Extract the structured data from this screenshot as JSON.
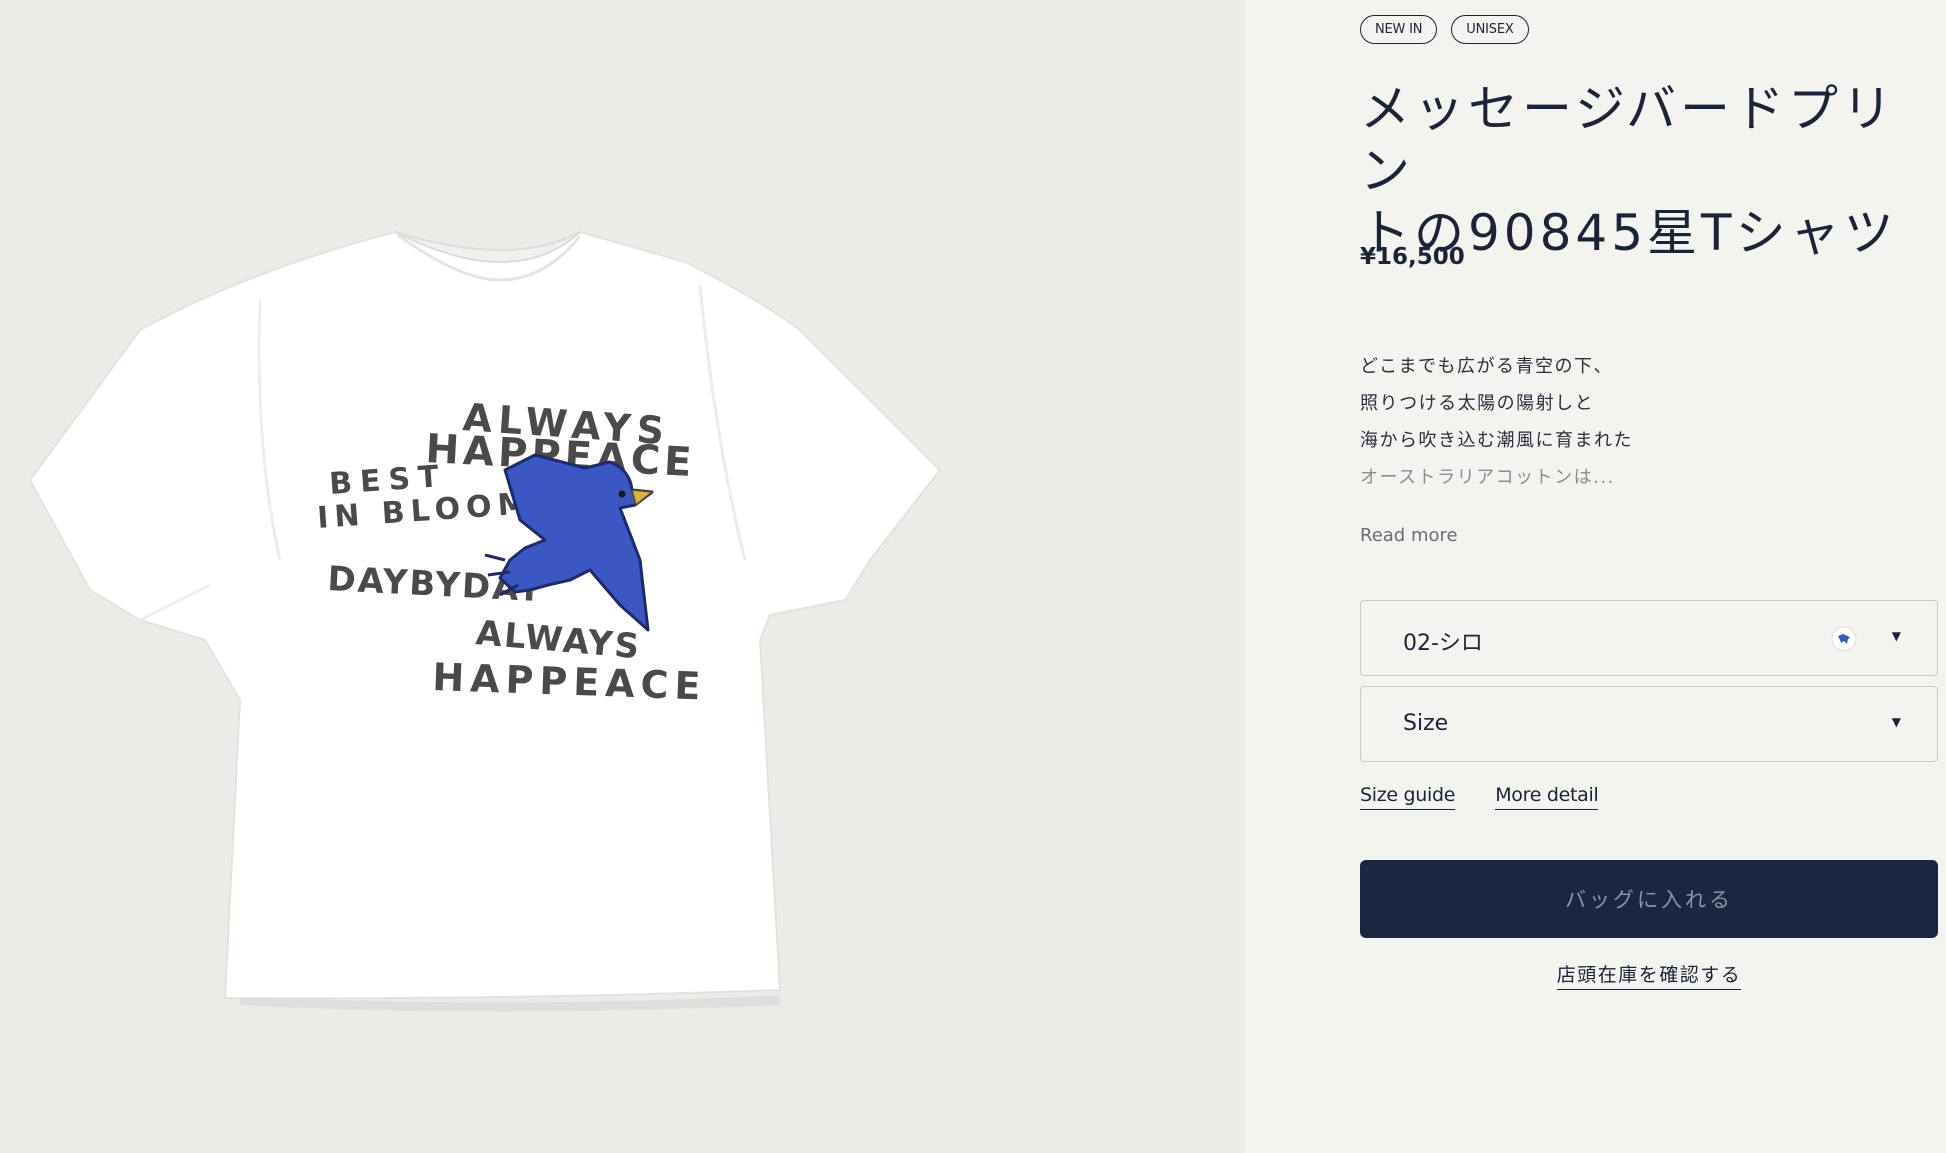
{
  "product": {
    "badges": [
      "NEW IN",
      "UNISEX"
    ],
    "title_lines": [
      "メッセージバードプリン",
      "トの90845星Tシャツ"
    ],
    "price": "¥16,500",
    "description_lines": [
      "どこまでも広がる青空の下、",
      "照りつける太陽の陽射しと",
      "海から吹き込む潮風に育まれた",
      "オーストラリアコットンは..."
    ],
    "read_more_label": "Read more"
  },
  "image": {
    "print_text": [
      "ALWAYS",
      "HAPPEACE",
      "BEST",
      "IN BLOOM",
      "DAYBYDAY",
      "ALWAYS",
      "HAPPEACE"
    ],
    "colors": {
      "shirt": "#ffffff",
      "bird": "#3b57c4",
      "print": "#4a4a4a"
    }
  },
  "options": {
    "color_value": "02-シロ",
    "color_swatch_icon": "bird-swatch-icon",
    "size_value": "Size"
  },
  "links": {
    "size_guide": "Size guide",
    "more_detail": "More detail"
  },
  "actions": {
    "add_to_bag": "バッグに入れる",
    "store_stock": "店頭在庫を確認する"
  },
  "colors": {
    "navy": "#1b2640",
    "panel_bg": "#f3f3f0",
    "gallery_bg": "#ebebe8"
  }
}
